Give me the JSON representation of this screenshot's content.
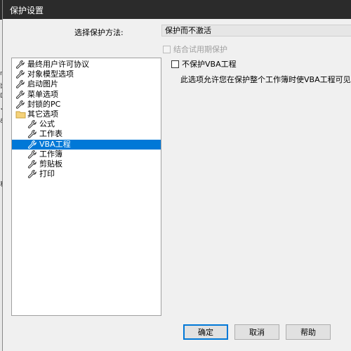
{
  "window": {
    "title": "保护设置"
  },
  "background": {
    "edge_glyphs": [
      "r",
      "比",
      "D",
      "✓",
      "&",
      "利"
    ]
  },
  "protection": {
    "method_label": "选择保护方法:",
    "method_value": "保护而不激活",
    "trial_label": "结合试用期保护"
  },
  "tree": {
    "items": [
      {
        "label": "最终用户许可协议",
        "icon": "wrench-icon",
        "indent": 0,
        "selected": false
      },
      {
        "label": "对象模型选项",
        "icon": "wrench-icon",
        "indent": 0,
        "selected": false
      },
      {
        "label": "启动图片",
        "icon": "wrench-icon",
        "indent": 0,
        "selected": false
      },
      {
        "label": "菜单选项",
        "icon": "wrench-icon",
        "indent": 0,
        "selected": false
      },
      {
        "label": "封锁的PC",
        "icon": "wrench-icon",
        "indent": 0,
        "selected": false
      },
      {
        "label": "其它选项",
        "icon": "folder-icon",
        "indent": 0,
        "selected": false
      },
      {
        "label": "公式",
        "icon": "wrench-icon",
        "indent": 1,
        "selected": false
      },
      {
        "label": "工作表",
        "icon": "wrench-icon",
        "indent": 1,
        "selected": false
      },
      {
        "label": "VBA工程",
        "icon": "wrench-icon",
        "indent": 1,
        "selected": true
      },
      {
        "label": "工作簿",
        "icon": "wrench-icon",
        "indent": 1,
        "selected": false
      },
      {
        "label": "剪贴板",
        "icon": "wrench-icon",
        "indent": 1,
        "selected": false
      },
      {
        "label": "打印",
        "icon": "wrench-icon",
        "indent": 1,
        "selected": false
      }
    ]
  },
  "panel": {
    "checkbox_label": "不保护VBA工程",
    "description": "此选项允许您在保护整个工作簿时使VBA工程可见"
  },
  "buttons": {
    "ok": "确定",
    "cancel": "取消",
    "help": "帮助"
  },
  "colors": {
    "selection": "#0078d7",
    "titlebar": "#2b2b2b",
    "dialog_bg": "#f0f0f0"
  }
}
